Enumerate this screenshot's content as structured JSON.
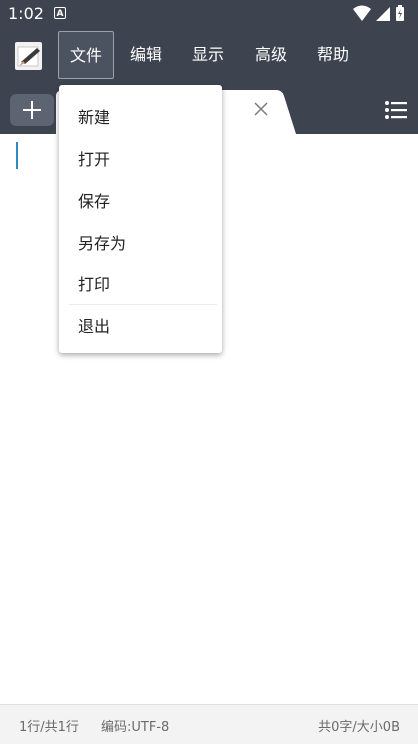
{
  "status_bar": {
    "time": "1:02",
    "notification_glyph": "A",
    "icons": [
      "wifi-icon",
      "signal-icon",
      "battery-icon"
    ]
  },
  "menu": {
    "items": [
      "文件",
      "编辑",
      "显示",
      "高级",
      "帮助"
    ],
    "active": "文件"
  },
  "file_menu": {
    "items": [
      "新建",
      "打开",
      "保存",
      "另存为",
      "打印",
      "退出"
    ]
  },
  "tab_bar": {
    "add_icon": "plus-icon",
    "close_icon": "close-icon",
    "list_icon": "list-icon"
  },
  "footer": {
    "line_info": "1行/共1行",
    "encoding": "编码:UTF-8",
    "size_info": "共0字/大小0B"
  },
  "colors": {
    "toolbar_bg": "#3d4450",
    "cursor": "#2e8cc0",
    "footer_bg": "#f3f3f3"
  }
}
